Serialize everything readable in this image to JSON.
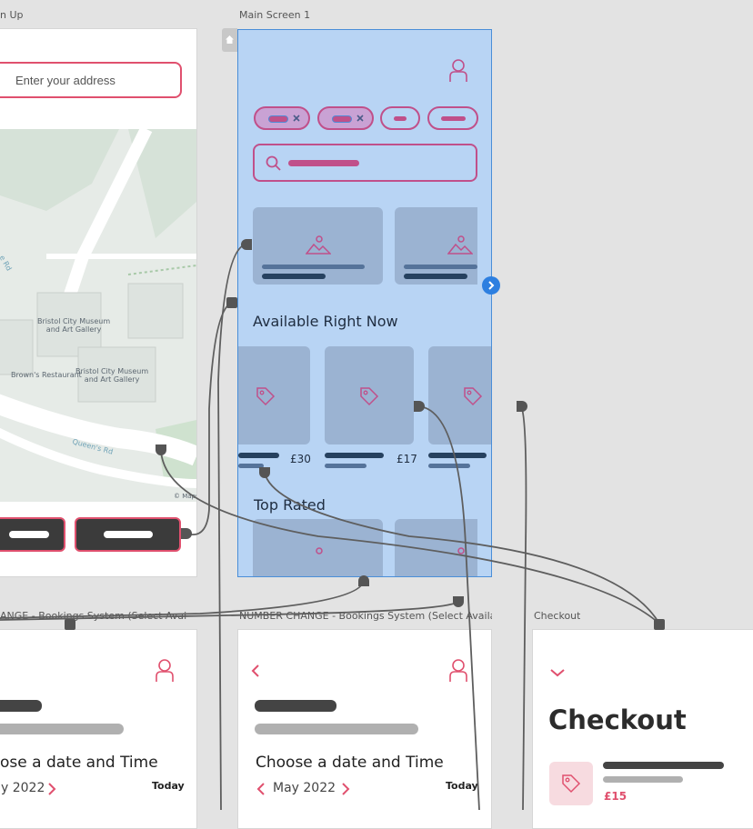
{
  "frames": {
    "signup_label": "n Up",
    "main_label": "Main Screen 1",
    "booking1_label": "ANGE - Bookings System (Select Available ...",
    "booking2_label": "NUMBER CHANGE - Bookings System (Select Available ...",
    "checkout_label": "Checkout"
  },
  "signup": {
    "address_placeholder": "Enter your address",
    "map_labels": {
      "museum1": "Bristol City Museum\nand Art Gallery",
      "museum2": "Bristol City Museum\nand Art Gallery",
      "restaurant": "Brown's Restaurant",
      "road1": "Queen's Rd",
      "road2": "e Rd",
      "maps": "© Maps"
    }
  },
  "main": {
    "available_heading": "Available Right Now",
    "top_rated_heading": "Top Rated",
    "prices": [
      "£30",
      "£17"
    ]
  },
  "booking1": {
    "heading": "ose a date and Time",
    "month": "y 2022",
    "today": "Today"
  },
  "booking2": {
    "heading": "Choose a date and Time",
    "month": "May 2022",
    "today": "Today"
  },
  "checkout": {
    "heading": "Checkout",
    "price": "£15"
  },
  "colors": {
    "canvas": "#e3e3e3",
    "selection_fill": "#b8d4f4",
    "selection_border": "#4a8ed8",
    "accent_pink": "#e0506e",
    "wire_magenta": "#c0508a",
    "card_blue": "#9bb3d2",
    "dark_navy": "#26415f"
  },
  "icons": [
    "home-icon",
    "user-icon",
    "search-icon",
    "image-icon",
    "tag-icon",
    "chevron-left-icon",
    "chevron-right-icon",
    "chevron-down-icon",
    "next-arrow-icon"
  ]
}
